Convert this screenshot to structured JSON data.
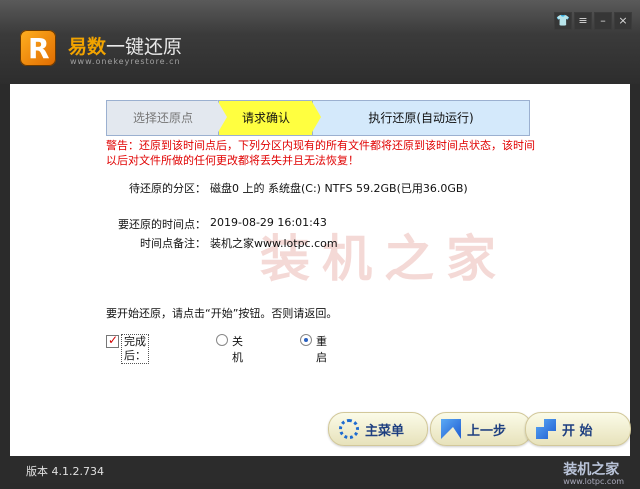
{
  "app": {
    "title_highlight": "易数",
    "title_rest": "一键还原",
    "url": "www.onekeyrestore.cn",
    "logo_letter": "R"
  },
  "window_controls": [
    "shirt-icon",
    "menu-icon",
    "minimize-icon",
    "close-icon"
  ],
  "steps": [
    {
      "label": "选择还原点"
    },
    {
      "label": "请求确认"
    },
    {
      "label": "执行还原(自动运行)"
    }
  ],
  "warning": "警告：还原到该时间点后，下列分区内现有的所有文件都将还原到该时间点状态，该时间以后对文件所做的任何更改都将丢失并且无法恢复！",
  "info": {
    "partition_label": "待还原的分区：",
    "partition_value": "磁盘0 上的 系统盘(C:) NTFS 59.2GB(已用36.0GB)",
    "time_label": "要还原的时间点：",
    "time_value": "2019-08-29 16:01:43",
    "note_label": "时间点备注：",
    "note_value": "装机之家www.lotpc.com"
  },
  "prompt": "要开始还原，请点击“开始”按钮。否则请返回。",
  "completion": {
    "label": "完成后：",
    "checked": true,
    "options": [
      {
        "label": "关机",
        "selected": false
      },
      {
        "label": "重启",
        "selected": true
      }
    ]
  },
  "buttons": {
    "menu": "主菜单",
    "prev": "上一步",
    "start": "开 始"
  },
  "watermark": {
    "center": "装机之家",
    "corner": "装机之家",
    "corner_url": "www.lotpc.com"
  },
  "version": "版本 4.1.2.734"
}
